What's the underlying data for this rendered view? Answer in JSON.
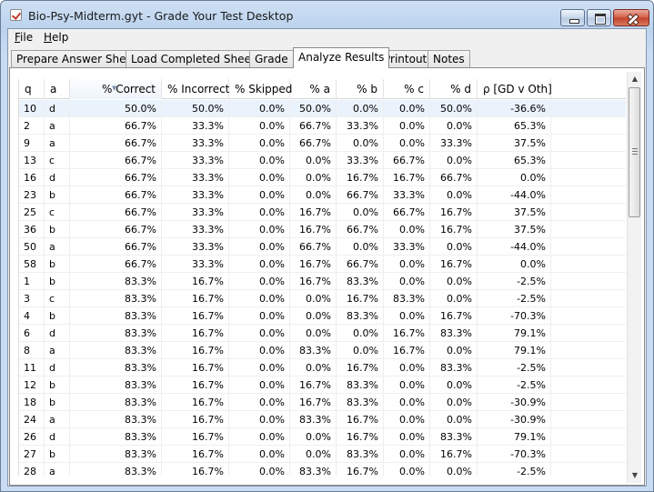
{
  "window": {
    "title": "Bio-Psy-Midterm.gyt - Grade Your Test Desktop"
  },
  "menu": [
    {
      "label": "File",
      "mnemonic": "F",
      "rest": "ile"
    },
    {
      "label": "Help",
      "mnemonic": "H",
      "rest": "elp"
    }
  ],
  "tabs": [
    {
      "label": "Prepare Answer Sheet",
      "active": false
    },
    {
      "label": "Load Completed Sheets",
      "active": false
    },
    {
      "label": "Grade",
      "active": false
    },
    {
      "label": "Analyze Results",
      "active": true
    },
    {
      "label": "Printout",
      "active": false
    },
    {
      "label": "Notes",
      "active": false
    }
  ],
  "table": {
    "sorted_column": "% Correct",
    "columns": [
      "q",
      "a",
      "% Correct",
      "% Incorrect",
      "% Skipped",
      "% a",
      "% b",
      "% c",
      "% d",
      "ρ [GD v Oth]"
    ],
    "rows": [
      [
        "10",
        "d",
        "50.0%",
        "50.0%",
        "0.0%",
        "50.0%",
        "0.0%",
        "0.0%",
        "50.0%",
        "-36.6%"
      ],
      [
        "2",
        "a",
        "66.7%",
        "33.3%",
        "0.0%",
        "66.7%",
        "33.3%",
        "0.0%",
        "0.0%",
        "65.3%"
      ],
      [
        "9",
        "a",
        "66.7%",
        "33.3%",
        "0.0%",
        "66.7%",
        "0.0%",
        "0.0%",
        "33.3%",
        "37.5%"
      ],
      [
        "13",
        "c",
        "66.7%",
        "33.3%",
        "0.0%",
        "0.0%",
        "33.3%",
        "66.7%",
        "0.0%",
        "65.3%"
      ],
      [
        "16",
        "d",
        "66.7%",
        "33.3%",
        "0.0%",
        "0.0%",
        "16.7%",
        "16.7%",
        "66.7%",
        "0.0%"
      ],
      [
        "23",
        "b",
        "66.7%",
        "33.3%",
        "0.0%",
        "0.0%",
        "66.7%",
        "33.3%",
        "0.0%",
        "-44.0%"
      ],
      [
        "25",
        "c",
        "66.7%",
        "33.3%",
        "0.0%",
        "16.7%",
        "0.0%",
        "66.7%",
        "16.7%",
        "37.5%"
      ],
      [
        "36",
        "b",
        "66.7%",
        "33.3%",
        "0.0%",
        "16.7%",
        "66.7%",
        "0.0%",
        "16.7%",
        "37.5%"
      ],
      [
        "50",
        "a",
        "66.7%",
        "33.3%",
        "0.0%",
        "66.7%",
        "0.0%",
        "33.3%",
        "0.0%",
        "-44.0%"
      ],
      [
        "58",
        "b",
        "66.7%",
        "33.3%",
        "0.0%",
        "16.7%",
        "66.7%",
        "0.0%",
        "16.7%",
        "0.0%"
      ],
      [
        "1",
        "b",
        "83.3%",
        "16.7%",
        "0.0%",
        "16.7%",
        "83.3%",
        "0.0%",
        "0.0%",
        "-2.5%"
      ],
      [
        "3",
        "c",
        "83.3%",
        "16.7%",
        "0.0%",
        "0.0%",
        "16.7%",
        "83.3%",
        "0.0%",
        "-2.5%"
      ],
      [
        "4",
        "b",
        "83.3%",
        "16.7%",
        "0.0%",
        "0.0%",
        "83.3%",
        "0.0%",
        "16.7%",
        "-70.3%"
      ],
      [
        "6",
        "d",
        "83.3%",
        "16.7%",
        "0.0%",
        "0.0%",
        "0.0%",
        "16.7%",
        "83.3%",
        "79.1%"
      ],
      [
        "8",
        "a",
        "83.3%",
        "16.7%",
        "0.0%",
        "83.3%",
        "0.0%",
        "16.7%",
        "0.0%",
        "79.1%"
      ],
      [
        "11",
        "d",
        "83.3%",
        "16.7%",
        "0.0%",
        "0.0%",
        "16.7%",
        "0.0%",
        "83.3%",
        "-2.5%"
      ],
      [
        "12",
        "b",
        "83.3%",
        "16.7%",
        "0.0%",
        "16.7%",
        "83.3%",
        "0.0%",
        "0.0%",
        "-2.5%"
      ],
      [
        "18",
        "b",
        "83.3%",
        "16.7%",
        "0.0%",
        "16.7%",
        "83.3%",
        "0.0%",
        "0.0%",
        "-30.9%"
      ],
      [
        "24",
        "a",
        "83.3%",
        "16.7%",
        "0.0%",
        "83.3%",
        "16.7%",
        "0.0%",
        "0.0%",
        "-30.9%"
      ],
      [
        "26",
        "d",
        "83.3%",
        "16.7%",
        "0.0%",
        "0.0%",
        "16.7%",
        "0.0%",
        "83.3%",
        "79.1%"
      ],
      [
        "27",
        "b",
        "83.3%",
        "16.7%",
        "0.0%",
        "0.0%",
        "83.3%",
        "0.0%",
        "16.7%",
        "-70.3%"
      ],
      [
        "28",
        "a",
        "83.3%",
        "16.7%",
        "0.0%",
        "83.3%",
        "16.7%",
        "0.0%",
        "0.0%",
        "-2.5%"
      ]
    ],
    "selected_row": 0
  },
  "scrollbar": {
    "up_icon": "scroll-up-arrow",
    "down_icon": "scroll-down-arrow"
  }
}
